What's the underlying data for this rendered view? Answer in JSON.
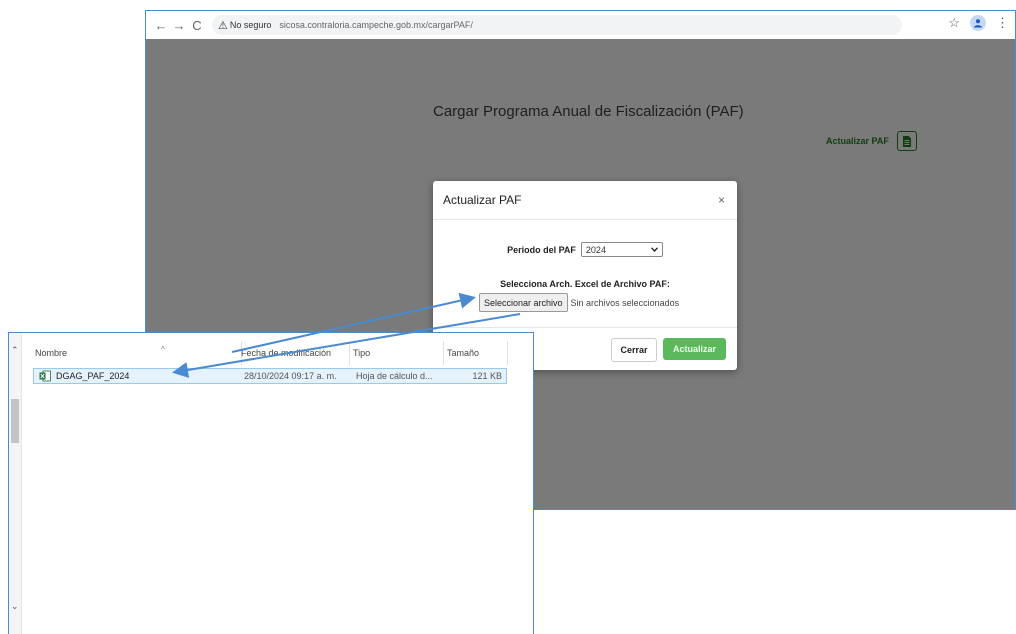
{
  "browser": {
    "nav": {
      "back": "←",
      "forward": "→",
      "reload": "C"
    },
    "security_icon": "warning-triangle-icon",
    "security_glyph": "⚠",
    "security_text": "No seguro",
    "url": "sicosa.contraloria.campeche.gob.mx/cargarPAF/",
    "bookmark_glyph": "☆",
    "profile_glyph": "👤",
    "menu_glyph": "⋮"
  },
  "page": {
    "title": "Cargar Programa Anual de Fiscalización (PAF)",
    "action_label": "Actualizar PAF",
    "action_icon": "excel-file-icon"
  },
  "modal": {
    "title": "Actualizar PAF",
    "close_glyph": "×",
    "periodo_label": "Periodo del PAF",
    "periodo_value": "2024",
    "file_label": "Selecciona Arch. Excel de Archivo PAF:",
    "file_button": "Seleccionar archivo",
    "file_status": "Sin archivos seleccionados",
    "btn_cerrar": "Cerrar",
    "btn_actualizar": "Actualizar"
  },
  "file_dialog": {
    "columns": {
      "nombre": "Nombre",
      "fecha": "Fecha de modificación",
      "tipo": "Tipo",
      "tamano": "Tamaño"
    },
    "files": [
      {
        "name": "DGAG_PAF_2024",
        "modified": "28/10/2024 09:17 a. m.",
        "type": "Hoja de cálculo d...",
        "size": "121 KB",
        "icon": "excel-file-icon"
      }
    ]
  },
  "colors": {
    "overlay": "#7a7a7a",
    "accent_green": "#5cb85c",
    "dark_green": "#0f3d0f",
    "arrow_blue": "#4a8ad0"
  }
}
